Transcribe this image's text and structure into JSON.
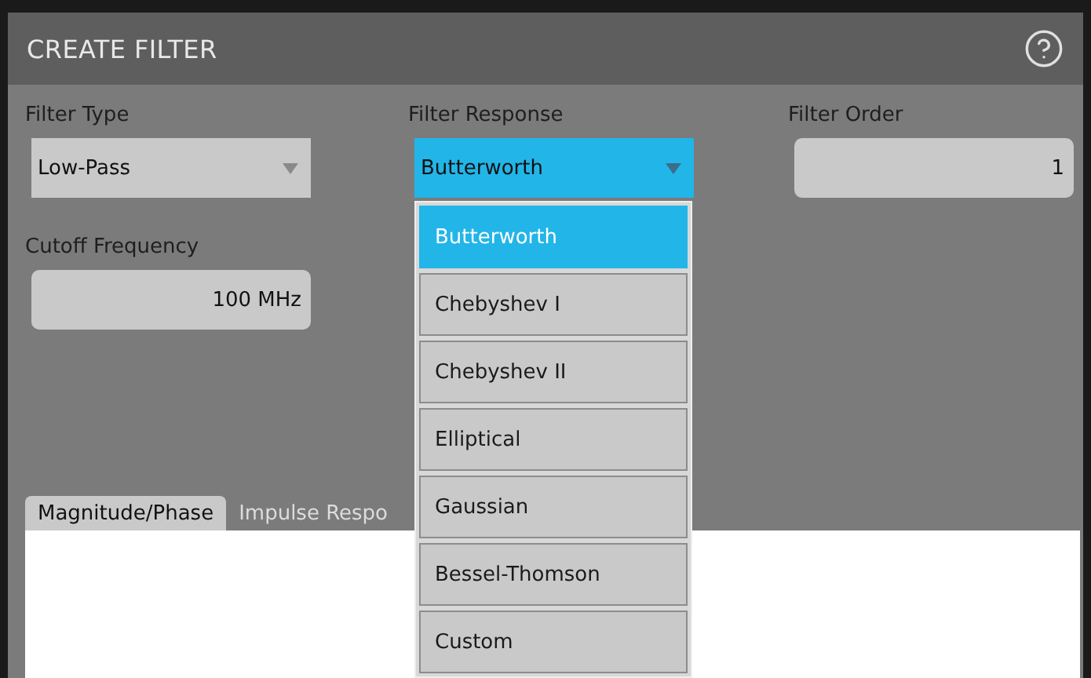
{
  "window": {
    "title": "CREATE FILTER"
  },
  "fields": [
    {
      "label": "Filter Type",
      "kind": "select",
      "value": "Low-Pass",
      "open": false
    },
    {
      "label": "Filter Response",
      "kind": "select",
      "value": "Butterworth",
      "open": true
    },
    {
      "label": "Filter Order",
      "kind": "number",
      "value": "1"
    },
    {
      "label": "Cutoff Frequency",
      "kind": "number",
      "value": "100 MHz"
    }
  ],
  "dropdown": {
    "options": [
      {
        "label": "Butterworth",
        "selected": true
      },
      {
        "label": "Chebyshev I",
        "selected": false
      },
      {
        "label": "Chebyshev II",
        "selected": false
      },
      {
        "label": "Elliptical",
        "selected": false
      },
      {
        "label": "Gaussian",
        "selected": false
      },
      {
        "label": "Bessel-Thomson",
        "selected": false
      },
      {
        "label": "Custom",
        "selected": false
      }
    ]
  },
  "tabs": [
    {
      "label": "Magnitude/Phase",
      "selected": true
    },
    {
      "label": "Impulse Respo",
      "selected": false
    }
  ]
}
